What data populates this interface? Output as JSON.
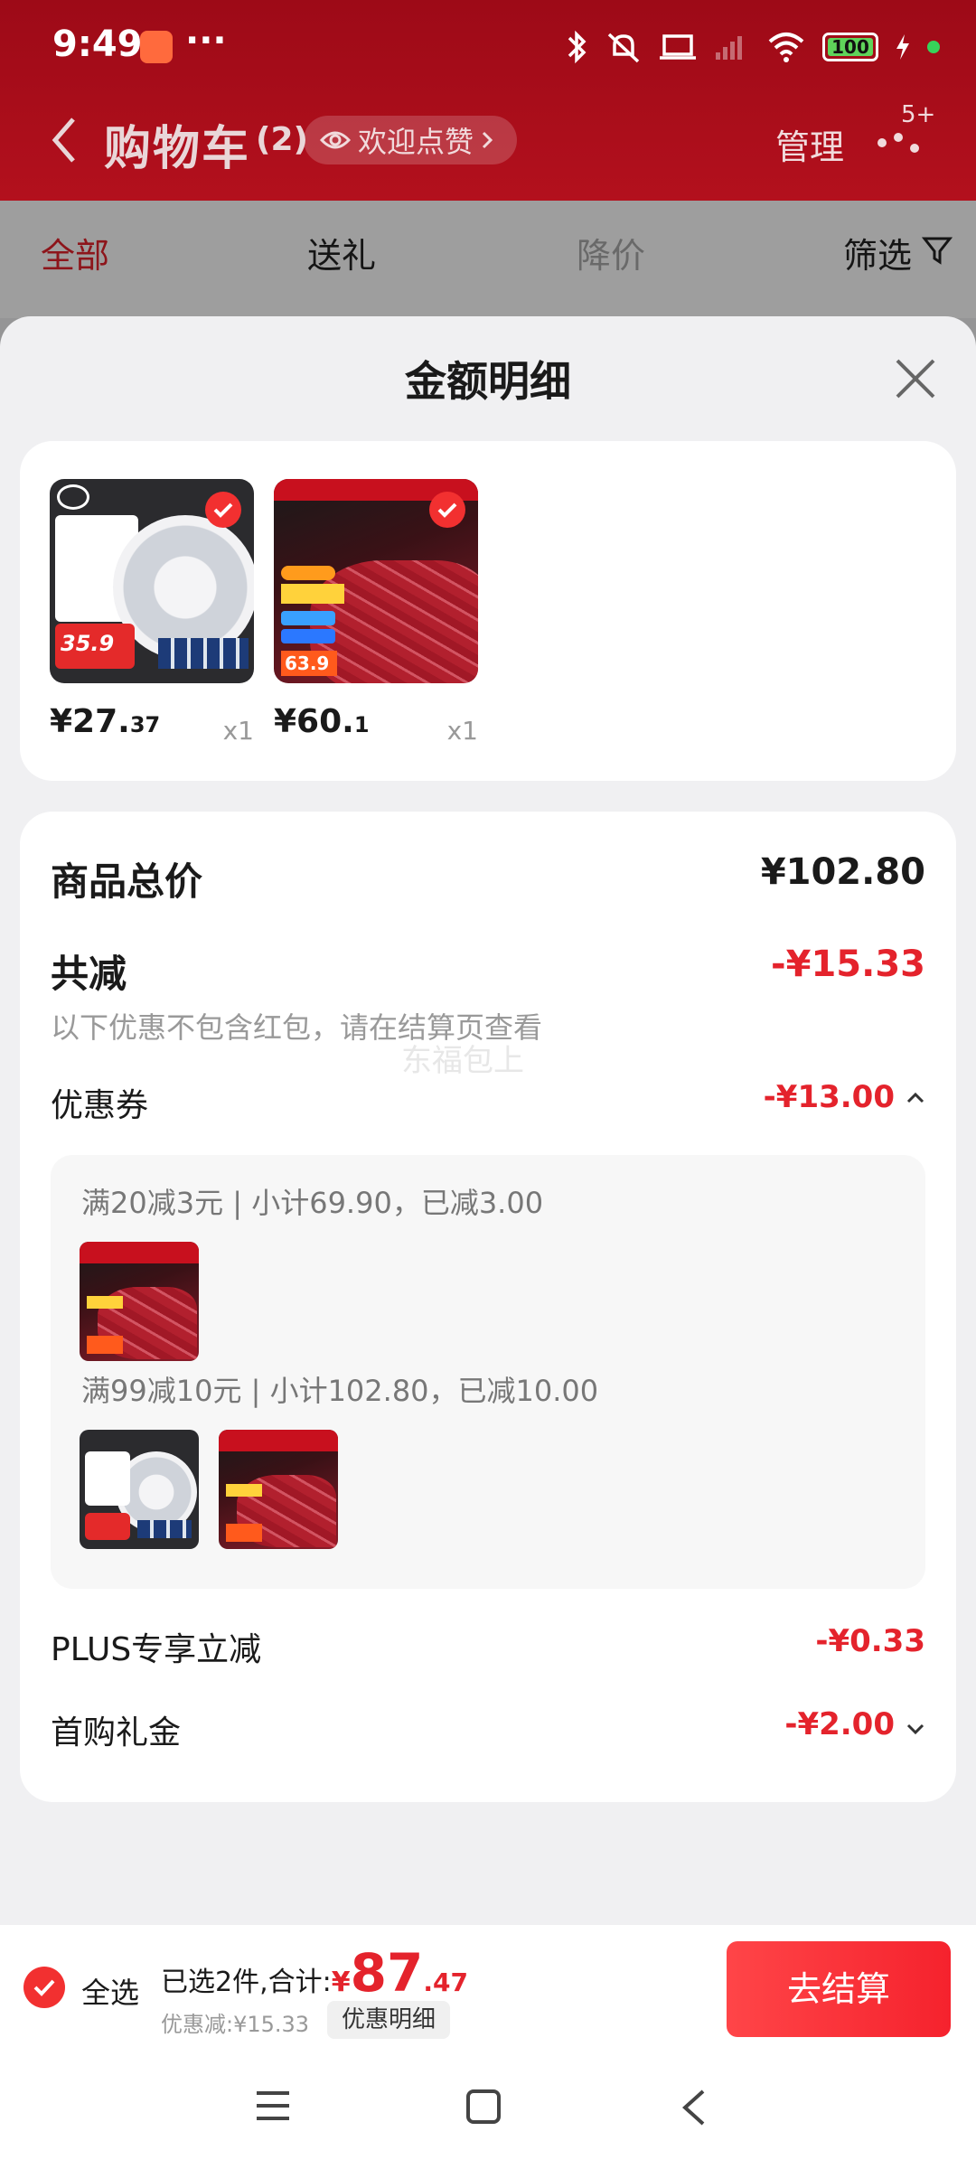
{
  "status_bar": {
    "time": "9:49",
    "more": "···",
    "battery": "100",
    "icons": [
      "bluetooth-icon",
      "mute-icon",
      "laptop-icon",
      "signal-icon",
      "wifi-icon",
      "battery-icon",
      "charging-icon"
    ]
  },
  "header": {
    "title": "购物车",
    "count": "(2)",
    "welcome_label": "欢迎点赞",
    "manage_label": "管理",
    "more_badge": "5+"
  },
  "tabs": [
    "全部",
    "送礼",
    "降价",
    "筛选"
  ],
  "sheet": {
    "title": "金额明细",
    "products": [
      {
        "price_int": "¥27.",
        "price_dec": "37",
        "qty": "x1",
        "promo_price": "35.9"
      },
      {
        "price_int": "¥60.",
        "price_dec": "1",
        "qty": "x1",
        "promo_price": "63.9"
      }
    ],
    "total_label": "商品总价",
    "total_value": "¥102.80",
    "reduce_label": "共减",
    "reduce_value": "-¥15.33",
    "reduce_note": "以下优惠不包含红包，请在结算页查看",
    "watermark": "东福包上",
    "coupon_label": "优惠券",
    "coupon_value": "-¥13.00",
    "coupon_lines": [
      "满20减3元 | 小计69.90，已减3.00",
      "满99减10元 | 小计102.80，已减10.00"
    ],
    "plus_label": "PLUS专享立减",
    "plus_value": "-¥0.33",
    "first_label": "首购礼金",
    "first_value": "-¥2.00"
  },
  "checkout": {
    "select_all": "全选",
    "summary_prefix": "已选2件,合计:",
    "currency": "¥",
    "amount_int": "87",
    "amount_dec": ".47",
    "discount_note": "优惠减:¥15.33",
    "detail_button": "优惠明细",
    "checkout_button": "去结算"
  },
  "colors": {
    "header_red": "#b3101d",
    "accent_red": "#e4232c",
    "button_red": "#f5222d"
  }
}
